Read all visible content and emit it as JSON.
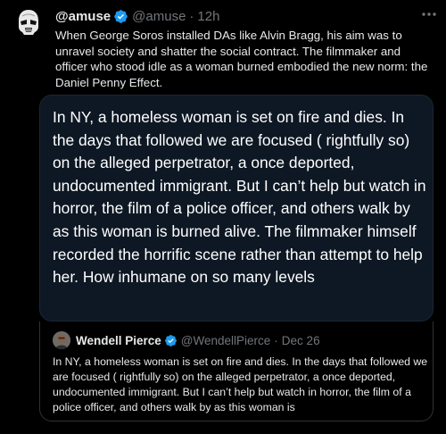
{
  "tweet": {
    "display_name": "@amuse",
    "handle": "@amuse",
    "separator": "·",
    "time": "12h",
    "text": "When George Soros installed DAs like Alvin Bragg, his aim was to unravel society and shatter the social contract. The filmmaker and officer who stood idle as a woman burned embodied the new norm: the Daniel Penny Effect.",
    "image_text": "In NY, a homeless woman is set on fire and dies. In the days that followed we are focused ( rightfully so) on the alleged perpetrator, a once deported, undocumented immigrant. But I can’t help but watch in horror, the film of a police officer, and others walk by as this woman is burned alive. The filmmaker himself recorded the horrific scene rather than attempt to help her. How inhumane on so many levels"
  },
  "quote": {
    "display_name": "Wendell Pierce",
    "handle": "@WendellPierce",
    "separator": "·",
    "date": "Dec 26",
    "text": "In NY, a homeless woman is set on fire and dies. In the days that followed we are focused ( rightfully so) on the alleged perpetrator, a once deported, undocumented immigrant. But I can’t help but watch in horror, the film of a police officer, and others walk by as this woman is"
  },
  "icons": {
    "avatar": "stormtrooper-avatar-icon",
    "verified": "verified-badge-icon",
    "more": "more-dots-icon"
  },
  "colors": {
    "background": "#000000",
    "text": "#e7e9ea",
    "secondary_text": "#71767b",
    "verified_blue": "#1d9bf0",
    "image_card_bg": "#0e1824",
    "border": "#2f3336"
  }
}
